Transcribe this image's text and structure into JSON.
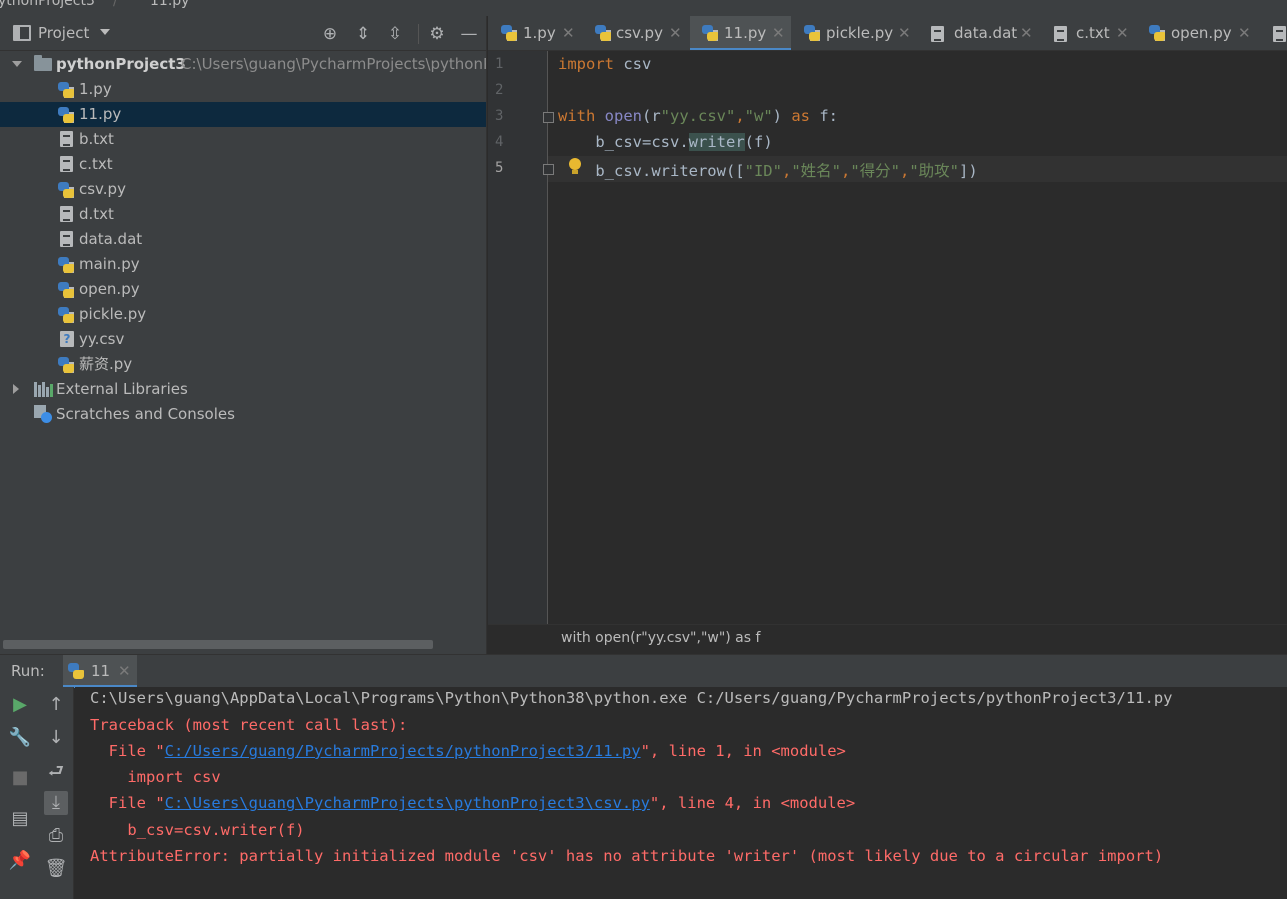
{
  "top_breadcrumb": {
    "project": "ythonProject3",
    "file": "11.py"
  },
  "project_panel": {
    "title": "Project",
    "toolbar_icons": [
      "locate-icon",
      "expand-all-icon",
      "collapse-all-icon",
      "gear-icon",
      "hide-icon"
    ],
    "root": {
      "name": "pythonProject3",
      "path": "C:\\Users\\guang\\PycharmProjects\\pythonP"
    },
    "files": [
      {
        "name": "1.py",
        "type": "py"
      },
      {
        "name": "11.py",
        "type": "py",
        "selected": true
      },
      {
        "name": "b.txt",
        "type": "txt"
      },
      {
        "name": "c.txt",
        "type": "txt"
      },
      {
        "name": "csv.py",
        "type": "py"
      },
      {
        "name": "d.txt",
        "type": "txt"
      },
      {
        "name": "data.dat",
        "type": "txt"
      },
      {
        "name": "main.py",
        "type": "py"
      },
      {
        "name": "open.py",
        "type": "py"
      },
      {
        "name": "pickle.py",
        "type": "py"
      },
      {
        "name": "yy.csv",
        "type": "csv"
      },
      {
        "name": "薪资.py",
        "type": "py"
      }
    ],
    "external_libraries": "External Libraries",
    "scratches": "Scratches and Consoles"
  },
  "tabs": [
    {
      "label": "1.py",
      "type": "py"
    },
    {
      "label": "csv.py",
      "type": "py"
    },
    {
      "label": "11.py",
      "type": "py",
      "active": true
    },
    {
      "label": "pickle.py",
      "type": "py"
    },
    {
      "label": "data.dat",
      "type": "txt"
    },
    {
      "label": "c.txt",
      "type": "txt"
    },
    {
      "label": "open.py",
      "type": "py"
    }
  ],
  "editor": {
    "line_numbers": [
      "1",
      "2",
      "3",
      "4",
      "5"
    ],
    "code": {
      "l1_kw": "import",
      "l1_rest": " csv",
      "l3_kw": "with",
      "l3_fn": "open",
      "l3_a": "(r",
      "l3_s1": "\"yy.csv\"",
      "l3_comma": ",",
      "l3_s2": "\"w\"",
      "l3_b": ") ",
      "l3_as": "as",
      "l3_c": " f:",
      "l4_a": "    b_csv=csv.",
      "l4_hl": "writer",
      "l4_b": "(f)",
      "l5_a": "    b_csv.writerow([",
      "l5_s1": "\"ID\"",
      "l5_c1": ",",
      "l5_s2": "\"姓名\"",
      "l5_c2": ",",
      "l5_s3": "\"得分\"",
      "l5_c3": ",",
      "l5_s4": "\"助攻\"",
      "l5_b": "])"
    },
    "breadcrumb": "with open(r\"yy.csv\",\"w\") as f"
  },
  "run_panel": {
    "label": "Run:",
    "tab": "11",
    "console": {
      "cmd": "C:\\Users\\guang\\AppData\\Local\\Programs\\Python\\Python38\\python.exe C:/Users/guang/PycharmProjects/pythonProject3/11.py",
      "traceback": "Traceback (most recent call last):",
      "f1_pre": "  File \"",
      "f1_link": "C:/Users/guang/PycharmProjects/pythonProject3/11.py",
      "f1_post": "\", line 1, in <module>",
      "f1_code": "    import csv",
      "f2_pre": "  File \"",
      "f2_link": "C:\\Users\\guang\\PycharmProjects\\pythonProject3\\csv.py",
      "f2_post": "\", line 4, in <module>",
      "f2_code": "    b_csv=csv.writer(f)",
      "error": "AttributeError: partially initialized module 'csv' has no attribute 'writer' (most likely due to a circular import)"
    }
  },
  "colors": {
    "keyword": "#cc7832",
    "string": "#6a8759",
    "builtin": "#8888c6",
    "error": "#ff6b68",
    "link": "#287bde",
    "selection": "#0d293e"
  }
}
